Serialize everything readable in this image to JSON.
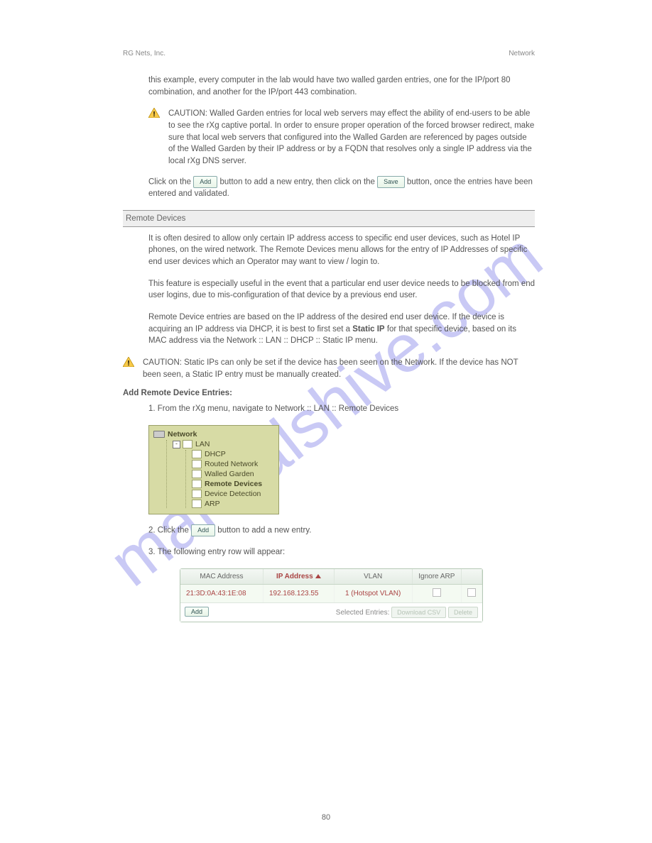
{
  "header": {
    "doc": "RG Nets, Inc.",
    "section": "Network"
  },
  "para1": "this example, every computer in the lab would have two walled garden entries, one for the IP/port 80 combination, and another for the IP/port 443 combination.",
  "warn1": "CAUTION:  Walled Garden entries for local web servers may effect the ability of end-users to be able to see the rXg captive portal. In order to ensure proper operation of the forced browser redirect, make sure that local web servers that configured into the Walled Garden are referenced by pages outside of the Walled Garden by their IP address or by a FQDN that resolves only a single IP address via the local rXg DNS server.",
  "para2_pre": "Click on the ",
  "para2_mid": " button to add a new entry, then click on the ",
  "para2_post": " button, once the entries have been entered and validated.",
  "btn_add": "Add",
  "btn_save": "Save",
  "section_title": "Remote Devices",
  "remote_intro": "It is often desired to allow only certain IP address access to specific end user devices, such as Hotel IP phones, on the wired network.  The Remote Devices menu allows for the entry of IP Addresses of specific end user devices which an Operator may want to view / login to.",
  "remote_p2": "This feature is especially useful in the event that a particular end user device needs to be blocked from end user logins, due to mis-configuration of that device by a previous end user.",
  "remote_p3_a": "Remote Device entries are based on the IP address of the desired end user device.  If the device is acquiring an IP address via DHCP, it is best to first set a ",
  "remote_p3_b": " for that specific device, based on its MAC address via the Network :: LAN :: DHCP :: Static IP menu.",
  "static_ip_label": "Static IP",
  "warn2": "CAUTION: Static IPs can only be set if the device has been seen on the Network.  If the device has NOT been seen, a Static IP entry must be manually created.",
  "add_heading": "Add Remote Device Entries:",
  "add_step1": "1.  From the rXg menu, navigate to Network :: LAN :: Remote Devices",
  "nav": {
    "root": "Network",
    "lan": "LAN",
    "items": [
      "DHCP",
      "Routed Network",
      "Walled Garden",
      "Remote Devices",
      "Device Detection",
      "ARP"
    ],
    "selected_index": 3
  },
  "add_step2_a": "2.  Click the ",
  "add_step2_b": " button to add a new entry.",
  "add_step3": "3.  The following entry row will appear:",
  "table": {
    "headers": [
      "MAC Address",
      "IP Address",
      "VLAN",
      "Ignore ARP",
      ""
    ],
    "sort_col": 1,
    "row": {
      "mac": "21:3D:0A:43:1E:08",
      "ip": "192.168.123.55",
      "vlan": "1 (Hotspot VLAN)"
    },
    "footer": {
      "add": "Add",
      "label": "Selected Entries:",
      "download": "Download CSV",
      "delete": "Delete"
    }
  },
  "page_no": "80"
}
